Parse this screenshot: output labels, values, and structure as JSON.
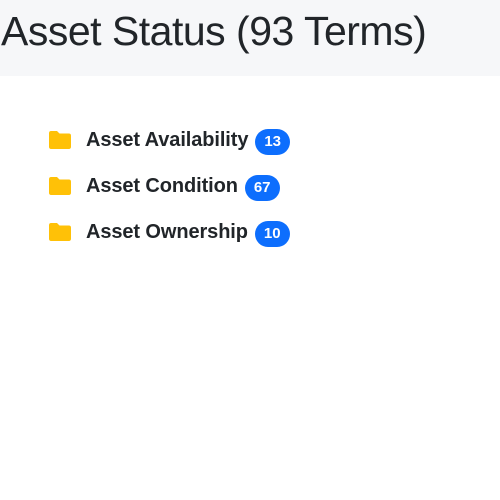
{
  "header": {
    "title": "Asset Status (93 Terms)"
  },
  "colors": {
    "folder": "#ffc107",
    "badge": "#0d6efd",
    "header_bg": "#f6f7f9"
  },
  "terms": [
    {
      "label": "Asset Availability",
      "count": "13",
      "icon": "folder-icon"
    },
    {
      "label": "Asset Condition",
      "count": "67",
      "icon": "folder-icon"
    },
    {
      "label": "Asset Ownership",
      "count": "10",
      "icon": "folder-icon"
    }
  ]
}
